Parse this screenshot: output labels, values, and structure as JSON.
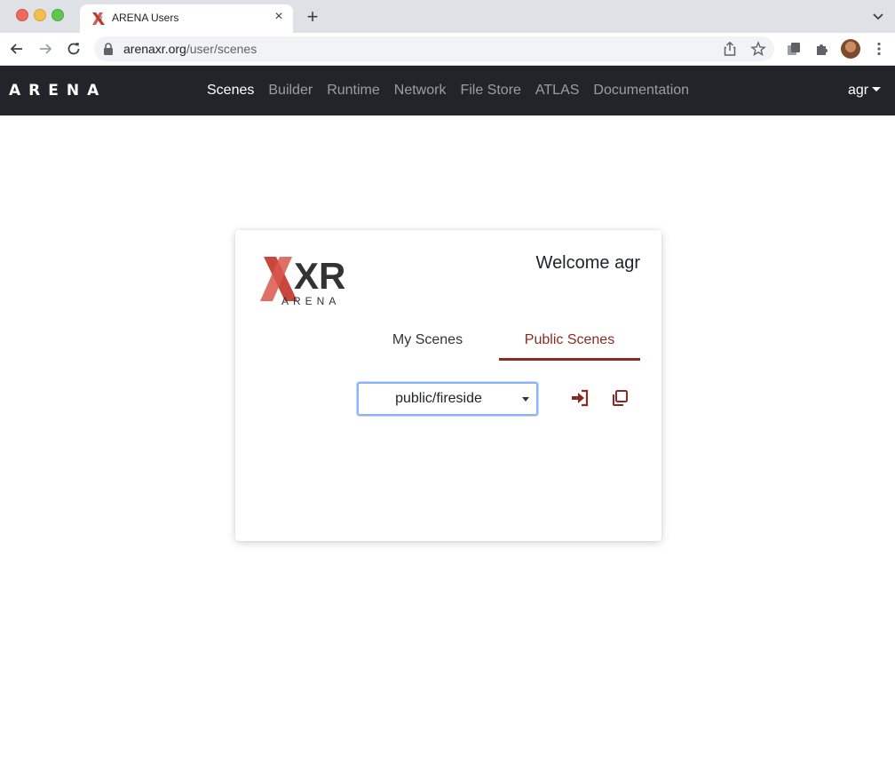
{
  "browser": {
    "tab_title": "ARENA Users",
    "url_host": "arenaxr.org",
    "url_path": "/user/scenes",
    "icons": [
      "back-icon",
      "forward-icon",
      "reload-icon",
      "lock-icon",
      "share-icon",
      "star-icon",
      "extension-icon",
      "puzzle-icon",
      "menu-dots-icon"
    ]
  },
  "navbar": {
    "brand": "ARENA",
    "links": [
      "Scenes",
      "Builder",
      "Runtime",
      "Network",
      "File Store",
      "ATLAS",
      "Documentation"
    ],
    "active_link": "Scenes",
    "user": "agr"
  },
  "card": {
    "logo_letters": "XR",
    "logo_sub": "ARENA",
    "welcome": "Welcome agr",
    "tabs": [
      "My Scenes",
      "Public Scenes"
    ],
    "active_tab": "Public Scenes",
    "scene_select_value": "public/fireside",
    "accent_color": "#8b2a22"
  }
}
